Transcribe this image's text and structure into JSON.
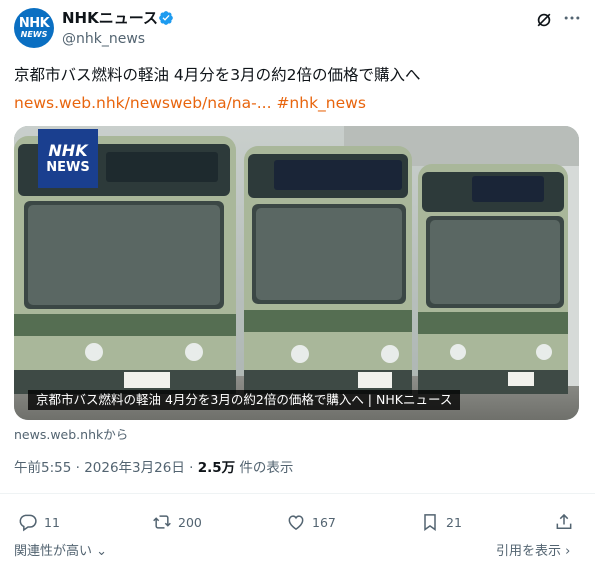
{
  "account": {
    "avatar_line1": "NHK",
    "avatar_line2": "NEWS",
    "name": "NHKニュース",
    "handle": "@nhk_news"
  },
  "tweet": {
    "text": "京都市バス燃料の軽油 4月分を3月の約2倍の価格で購入へ",
    "link": "news.web.nhk/newsweb/na/na-...",
    "hashtag": "#nhk_news"
  },
  "card": {
    "badge_line1": "NHK",
    "badge_line2": "NEWS",
    "caption": "京都市バス燃料の軽油 4月分を3月の約2倍の価格で購入へ | NHKニュース",
    "source": "news.web.nhkから"
  },
  "meta": {
    "time": "午前5:55",
    "date": "2026年3月26日",
    "views": "2.5万",
    "views_label": "件の表示"
  },
  "actions": {
    "replies": "11",
    "reposts": "200",
    "likes": "167",
    "bookmarks": "21"
  },
  "footer": {
    "related": "関連性が高い",
    "quotes": "引用を表示"
  },
  "colors": {
    "link": "#e8650e",
    "verified": "#1d9bf0",
    "avatar": "#0a6fc2"
  }
}
